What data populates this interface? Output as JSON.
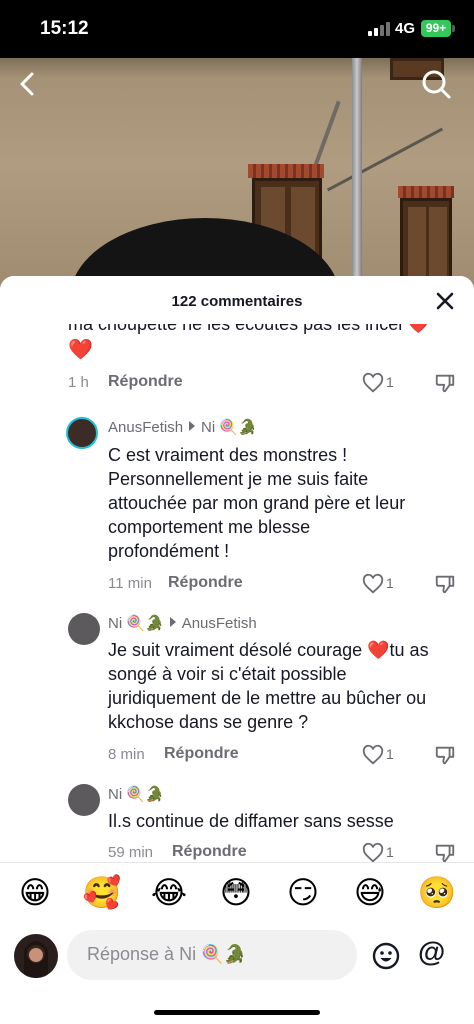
{
  "status_bar": {
    "time": "15:12",
    "network": "4G",
    "battery": "99+"
  },
  "video": {
    "description_icons": [
      "back-icon",
      "search-icon"
    ]
  },
  "comments_sheet": {
    "title": "122 commentaires",
    "comments": [
      {
        "text_line1": "ma choupette ne les écoutes pas les incel ❤️",
        "text_line2": "❤️",
        "time": "1 h",
        "reply_label": "Répondre",
        "likes": "1"
      },
      {
        "user": "AnusFetish",
        "reply_to": "Ni 🍭🐊",
        "text": "C est vraiment des monstres ! Personnellement je me suis faite attouchée par mon grand père et leur comportement me blesse profondément !",
        "lines": [
          "C est vraiment des monstres !",
          "Personnellement je me suis faite",
          "attouchée par mon grand père et leur",
          "comportement me blesse",
          "profondément !"
        ],
        "time": "11 min",
        "reply_label": "Répondre",
        "likes": "1"
      },
      {
        "user": "Ni 🍭🐊",
        "reply_to": "AnusFetish",
        "lines": [
          "Je suit vraiment désolé courage ❤️tu as",
          "songé à voir si c'était possible",
          "juridiquement de le mettre au bûcher ou",
          "kkchose dans se genre ?"
        ],
        "time": "8 min",
        "reply_label": "Répondre",
        "likes": "1"
      },
      {
        "user": "Ni 🍭🐊",
        "lines": [
          "Il.s continue de diffamer sans sesse"
        ],
        "time": "59 min",
        "reply_label": "Répondre",
        "likes": "1"
      }
    ]
  },
  "emoji_bar": [
    "😁",
    "🥰",
    "😂",
    "😳",
    "😏",
    "😅",
    "🥺"
  ],
  "composer": {
    "placeholder": "Réponse à Ni 🍭🐊",
    "at_label": "@"
  }
}
